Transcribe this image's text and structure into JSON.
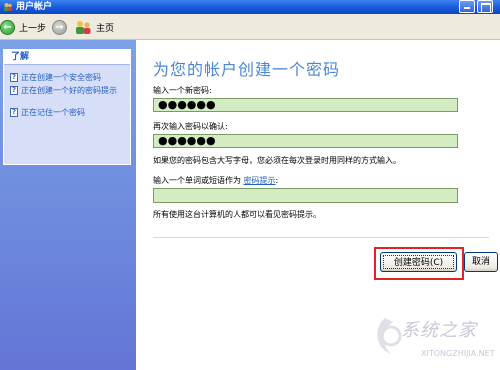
{
  "window": {
    "title": "用户帐户"
  },
  "toolbar": {
    "back_label": "上一步",
    "back_glyph": "←",
    "forward_glyph": "→",
    "home_label": "主页"
  },
  "sidebar": {
    "header": "了解",
    "items": [
      {
        "label": "正在创建一个安全密码",
        "icon": "help-doc-icon"
      },
      {
        "label": "正在创建一个好的密码提示",
        "icon": "help-doc-icon"
      },
      {
        "label": "正在记住一个密码",
        "icon": "help-doc-icon"
      }
    ],
    "item_icon_glyph": "?"
  },
  "main": {
    "title": "为您的帐户创建一个密码",
    "new_password_label": "输入一个新密码:",
    "new_password_value": "●●●●●●",
    "confirm_label": "再次输入密码以确认:",
    "confirm_value": "●●●●●●",
    "case_note": "如果您的密码包含大写字母，您必须在每次登录时用同样的方式输入。",
    "hint_label_prefix": "输入一个单词或短语作为",
    "hint_link": "密码提示",
    "hint_label_suffix": ":",
    "hint_value": "",
    "visibility_note": "所有使用这台计算机的人都可以看见密码提示。",
    "create_button": "创建密码(C)",
    "cancel_button": "取消"
  },
  "watermark": {
    "text": "系统之家",
    "url": "XITONGZHIJIA.NET"
  },
  "colors": {
    "titlebar": "#1457d9",
    "sidebar": "#6f8ce0",
    "field_bg": "#d4ecc2",
    "title_text": "#4a86d6",
    "link": "#215dc6",
    "highlight": "#e02525"
  }
}
